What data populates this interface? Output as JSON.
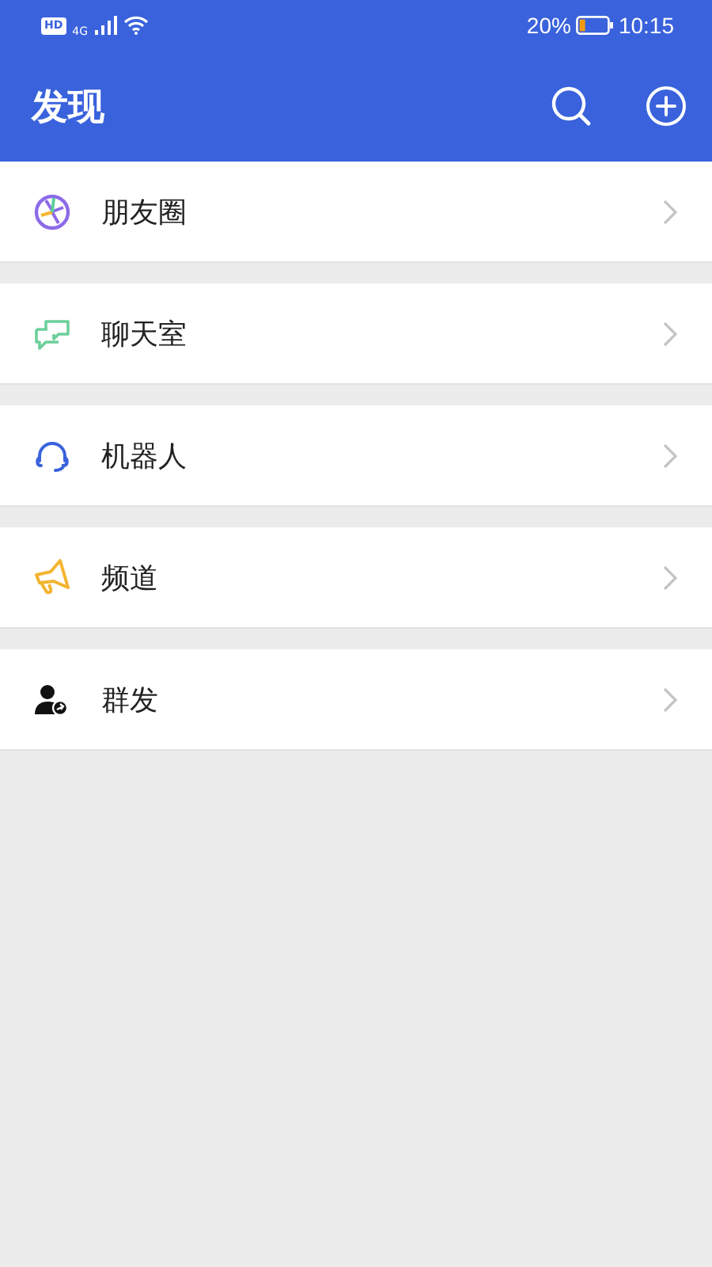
{
  "status_bar": {
    "hd_badge": "HD",
    "battery_percent": "20%",
    "time": "10:15",
    "network": "4G"
  },
  "header": {
    "title": "发现"
  },
  "items": [
    {
      "kind": "moments",
      "label": "朋友圈"
    },
    {
      "kind": "chat",
      "label": "聊天室"
    },
    {
      "kind": "robot",
      "label": "机器人"
    },
    {
      "kind": "channel",
      "label": "频道"
    },
    {
      "kind": "broadcast",
      "label": "群发"
    }
  ]
}
